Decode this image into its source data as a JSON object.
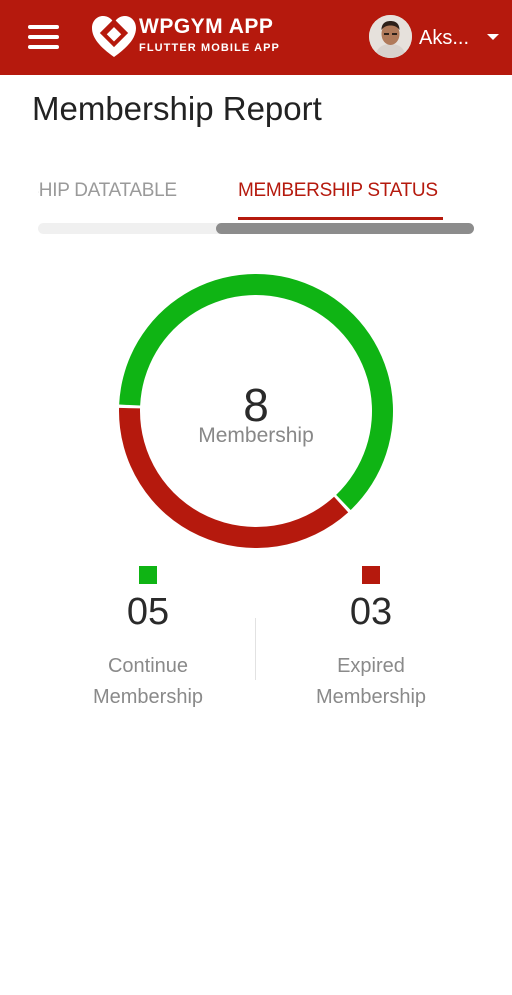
{
  "header": {
    "brand_title": "WPGYM APP",
    "brand_subtitle": "FLUTTER MOBILE APP",
    "user_name": "Aks...",
    "background_color": "#b5190d"
  },
  "page": {
    "title": "Membership Report"
  },
  "tabs": [
    {
      "label": "MEMBERSHIP DATATABLE",
      "visible_label": "RSHIP DATATABLE",
      "active": false
    },
    {
      "label": "MEMBERSHIP STATUS",
      "visible_label": "MEMBERSHIP STATUS",
      "active": true
    }
  ],
  "summary": {
    "total": "8",
    "total_label": "Membership"
  },
  "legend": [
    {
      "value": "05",
      "label_line1": "Continue",
      "label_line2": "Membership",
      "color": "#0fb414"
    },
    {
      "value": "03",
      "label_line1": "Expired",
      "label_line2": "Membership",
      "color": "#b5190d"
    }
  ],
  "chart_data": {
    "type": "pie",
    "title": "",
    "categories": [
      "Continue Membership",
      "Expired Membership"
    ],
    "values": [
      5,
      3
    ],
    "colors": [
      "#0fb414",
      "#b5190d"
    ],
    "total": 8
  }
}
